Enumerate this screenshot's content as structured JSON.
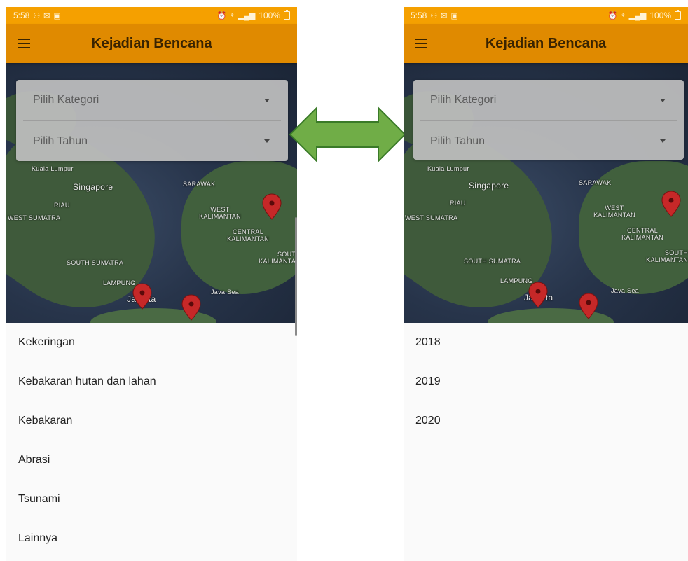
{
  "colors": {
    "status_bar": "#f5a000",
    "app_bar": "#e08a00",
    "marker": "#c62828",
    "arrow_fill": "#70ad47",
    "arrow_stroke": "#3a7a28"
  },
  "status_bar": {
    "time": "5:58",
    "battery": "100%"
  },
  "app_bar": {
    "title": "Kejadian Bencana",
    "menu_icon": "hamburger-menu-icon"
  },
  "map": {
    "labels": {
      "kuala_lumpur": "Kuala Lumpur",
      "singapore": "Singapore",
      "riau": "RIAU",
      "west_sumatra": "WEST SUMATRA",
      "sarawak": "SARAWAK",
      "west_kalimantan": "WEST KALIMANTAN",
      "central_kalimantan": "CENTRAL KALIMANTAN",
      "south_kalimantan": "SOUTH KALIMANTAN",
      "south_sumatra": "SOUTH SUMATRA",
      "lampung": "LAMPUNG",
      "java_sea": "Java Sea",
      "jakarta": "Jakarta"
    }
  },
  "filters": {
    "category_placeholder": "Pilih Kategori",
    "year_placeholder": "Pilih Tahun"
  },
  "left_screen": {
    "options": [
      "Kekeringan",
      "Kebakaran hutan dan lahan",
      "Kebakaran",
      "Abrasi",
      "Tsunami",
      "Lainnya"
    ]
  },
  "right_screen": {
    "options": [
      "2018",
      "2019",
      "2020"
    ]
  }
}
